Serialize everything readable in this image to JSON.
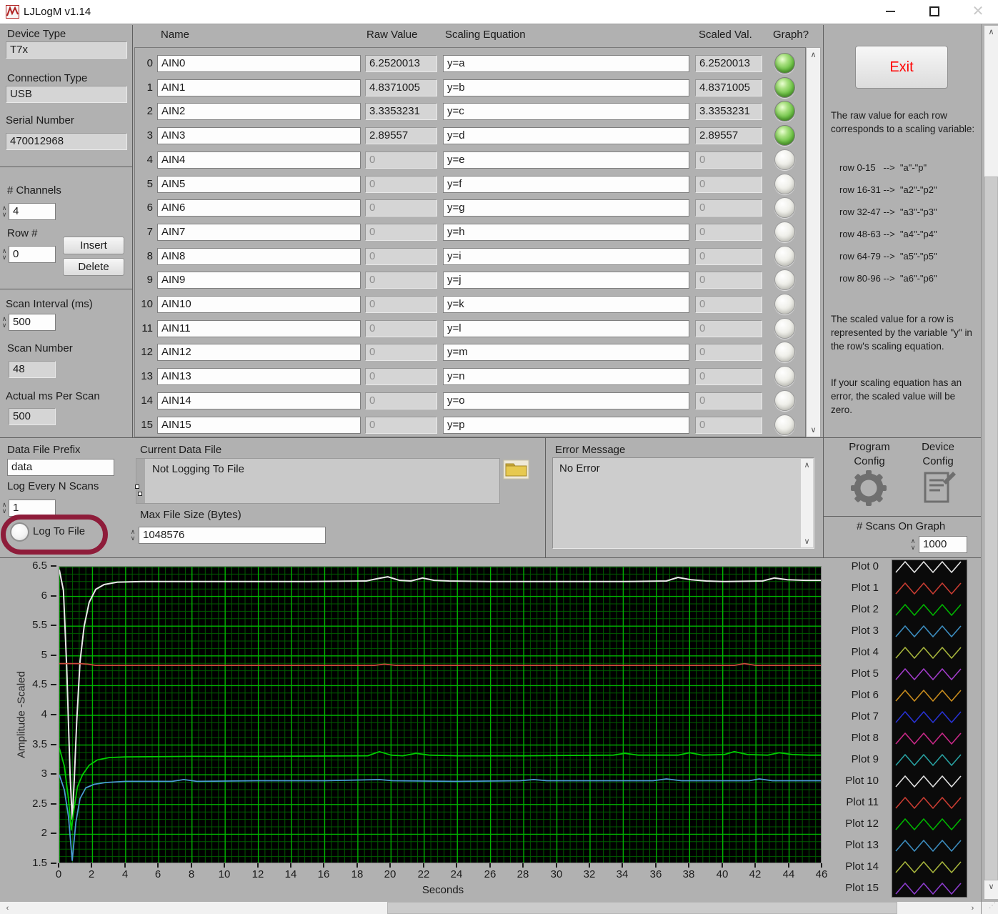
{
  "window": {
    "title": "LJLogM v1.14"
  },
  "left_panel": {
    "device_type_label": "Device Type",
    "device_type": "T7x",
    "connection_type_label": "Connection Type",
    "connection_type": "USB",
    "serial_number_label": "Serial Number",
    "serial_number": "470012968",
    "num_channels_label": "# Channels",
    "num_channels": "4",
    "row_label": "Row #",
    "row_value": "0",
    "insert_label": "Insert",
    "delete_label": "Delete",
    "scan_interval_label": "Scan Interval (ms)",
    "scan_interval": "500",
    "scan_number_label": "Scan Number",
    "scan_number": "48",
    "actual_ms_label": "Actual ms Per Scan",
    "actual_ms": "500"
  },
  "table": {
    "headers": {
      "name": "Name",
      "raw": "Raw Value",
      "equation": "Scaling Equation",
      "scaled": "Scaled Val.",
      "graph": "Graph?"
    },
    "rows": [
      {
        "idx": "0",
        "name": "AIN0",
        "raw": "6.2520013",
        "eq": "y=a",
        "scaled": "6.2520013",
        "on": true
      },
      {
        "idx": "1",
        "name": "AIN1",
        "raw": "4.8371005",
        "eq": "y=b",
        "scaled": "4.8371005",
        "on": true
      },
      {
        "idx": "2",
        "name": "AIN2",
        "raw": "3.3353231",
        "eq": "y=c",
        "scaled": "3.3353231",
        "on": true
      },
      {
        "idx": "3",
        "name": "AIN3",
        "raw": "2.89557",
        "eq": "y=d",
        "scaled": "2.89557",
        "on": true
      },
      {
        "idx": "4",
        "name": "AIN4",
        "raw": "0",
        "eq": "y=e",
        "scaled": "0",
        "on": false
      },
      {
        "idx": "5",
        "name": "AIN5",
        "raw": "0",
        "eq": "y=f",
        "scaled": "0",
        "on": false
      },
      {
        "idx": "6",
        "name": "AIN6",
        "raw": "0",
        "eq": "y=g",
        "scaled": "0",
        "on": false
      },
      {
        "idx": "7",
        "name": "AIN7",
        "raw": "0",
        "eq": "y=h",
        "scaled": "0",
        "on": false
      },
      {
        "idx": "8",
        "name": "AIN8",
        "raw": "0",
        "eq": "y=i",
        "scaled": "0",
        "on": false
      },
      {
        "idx": "9",
        "name": "AIN9",
        "raw": "0",
        "eq": "y=j",
        "scaled": "0",
        "on": false
      },
      {
        "idx": "10",
        "name": "AIN10",
        "raw": "0",
        "eq": "y=k",
        "scaled": "0",
        "on": false
      },
      {
        "idx": "11",
        "name": "AIN11",
        "raw": "0",
        "eq": "y=l",
        "scaled": "0",
        "on": false
      },
      {
        "idx": "12",
        "name": "AIN12",
        "raw": "0",
        "eq": "y=m",
        "scaled": "0",
        "on": false
      },
      {
        "idx": "13",
        "name": "AIN13",
        "raw": "0",
        "eq": "y=n",
        "scaled": "0",
        "on": false
      },
      {
        "idx": "14",
        "name": "AIN14",
        "raw": "0",
        "eq": "y=o",
        "scaled": "0",
        "on": false
      },
      {
        "idx": "15",
        "name": "AIN15",
        "raw": "0",
        "eq": "y=p",
        "scaled": "0",
        "on": false
      }
    ]
  },
  "right_panel": {
    "exit_label": "Exit",
    "raw_note": "The raw value for each row corresponds to a scaling variable:",
    "row_map": [
      "row 0-15   -->  \"a\"-\"p\"",
      "row 16-31 -->  \"a2\"-\"p2\"",
      "row 32-47 -->  \"a3\"-\"p3\"",
      "row 48-63 -->  \"a4\"-\"p4\"",
      "row 64-79 -->  \"a5\"-\"p5\"",
      "row 80-96 -->  \"a6\"-\"p6\""
    ],
    "scaled_note": "The scaled value for a row is represented by the variable  \"y\" in the row's scaling equation.",
    "error_note": "If your scaling  equation has an error, the scaled value will be zero."
  },
  "logging": {
    "data_file_prefix_label": "Data File Prefix",
    "data_file_prefix": "data",
    "log_every_label": "Log Every N Scans",
    "log_every": "1",
    "log_to_file_label": "Log To File",
    "current_data_file_label": "Current Data File",
    "current_data_file": "Not Logging To File",
    "max_file_size_label": "Max File Size (Bytes)",
    "max_file_size": "1048576"
  },
  "error_panel": {
    "label": "Error Message",
    "message": "No Error"
  },
  "config": {
    "program_label": "Program\nConfig",
    "device_label": "Device\nConfig"
  },
  "graph": {
    "scans_label": "# Scans On Graph",
    "scans_value": "1000",
    "legend": [
      {
        "label": "Plot 0",
        "color": "#e4e4e4"
      },
      {
        "label": "Plot 1",
        "color": "#c83c32"
      },
      {
        "label": "Plot 2",
        "color": "#00b400"
      },
      {
        "label": "Plot 3",
        "color": "#3c8cbe"
      },
      {
        "label": "Plot 4",
        "color": "#a6b43c"
      },
      {
        "label": "Plot 5",
        "color": "#a03cc8"
      },
      {
        "label": "Plot 6",
        "color": "#c88c1e"
      },
      {
        "label": "Plot 7",
        "color": "#2832d2"
      },
      {
        "label": "Plot 8",
        "color": "#c82887"
      },
      {
        "label": "Plot 9",
        "color": "#28a0a0"
      },
      {
        "label": "Plot 10",
        "color": "#e0e0e0"
      },
      {
        "label": "Plot 11",
        "color": "#c83c32"
      },
      {
        "label": "Plot 12",
        "color": "#00b400"
      },
      {
        "label": "Plot 13",
        "color": "#3c8cbe"
      },
      {
        "label": "Plot 14",
        "color": "#a6b43c"
      },
      {
        "label": "Plot 15",
        "color": "#8c3ccd"
      }
    ]
  },
  "colors": {
    "background": "#b1b1b1",
    "led_on": "#6cc244",
    "exit_text": "#ff0000",
    "annotation_ring": "#8e1c3a",
    "graph_bg": "#000000",
    "grid_major": "#00b400",
    "grid_minor": "#005c00"
  },
  "chart_data": {
    "type": "line",
    "xlabel": "Seconds",
    "ylabel": "Amplitude -Scaled",
    "xlim": [
      0,
      46
    ],
    "ylim": [
      1.5,
      6.5
    ],
    "x_ticks": [
      0,
      2,
      4,
      6,
      8,
      10,
      12,
      14,
      16,
      18,
      20,
      22,
      24,
      26,
      28,
      30,
      32,
      34,
      36,
      38,
      40,
      42,
      44,
      46
    ],
    "y_ticks": [
      6.5,
      6,
      5.5,
      5,
      4.5,
      4,
      3.5,
      3,
      2.5,
      2,
      1.5
    ],
    "grid": {
      "x_major": 2,
      "x_minor": 0.4,
      "y_major": 0.5,
      "y_minor": 0.125,
      "major_color": "#00b400",
      "minor_color": "#005c00"
    },
    "legend_position": "right",
    "series": [
      {
        "name": "AIN0",
        "color": "#e9e9e9",
        "points": [
          [
            0,
            6.45
          ],
          [
            0.25,
            6.1
          ],
          [
            0.45,
            4.8
          ],
          [
            0.65,
            3.0
          ],
          [
            0.78,
            2.25
          ],
          [
            0.9,
            2.9
          ],
          [
            1.05,
            3.9
          ],
          [
            1.25,
            4.9
          ],
          [
            1.5,
            5.5
          ],
          [
            1.8,
            5.9
          ],
          [
            2.2,
            6.12
          ],
          [
            2.7,
            6.2
          ],
          [
            3.5,
            6.24
          ],
          [
            5,
            6.25
          ],
          [
            10,
            6.25
          ],
          [
            15,
            6.25
          ],
          [
            18.5,
            6.26
          ],
          [
            19.2,
            6.3
          ],
          [
            19.8,
            6.33
          ],
          [
            20.5,
            6.27
          ],
          [
            21.2,
            6.26
          ],
          [
            21.9,
            6.31
          ],
          [
            22.6,
            6.27
          ],
          [
            23.5,
            6.26
          ],
          [
            26,
            6.25
          ],
          [
            30,
            6.25
          ],
          [
            34,
            6.25
          ],
          [
            36.6,
            6.26
          ],
          [
            37.3,
            6.32
          ],
          [
            38.1,
            6.28
          ],
          [
            39,
            6.26
          ],
          [
            40,
            6.25
          ],
          [
            42.4,
            6.26
          ],
          [
            43.1,
            6.31
          ],
          [
            43.9,
            6.28
          ],
          [
            45,
            6.27
          ],
          [
            46,
            6.27
          ]
        ]
      },
      {
        "name": "AIN1",
        "color": "#cd4a3c",
        "points": [
          [
            0,
            4.87
          ],
          [
            0.5,
            4.87
          ],
          [
            1.2,
            4.87
          ],
          [
            1.7,
            4.86
          ],
          [
            2.2,
            4.84
          ],
          [
            4,
            4.84
          ],
          [
            10,
            4.84
          ],
          [
            19,
            4.84
          ],
          [
            19.6,
            4.86
          ],
          [
            20.3,
            4.84
          ],
          [
            30,
            4.84
          ],
          [
            40.7,
            4.84
          ],
          [
            41.3,
            4.87
          ],
          [
            42,
            4.84
          ],
          [
            46,
            4.84
          ]
        ]
      },
      {
        "name": "AIN2",
        "color": "#00cd00",
        "points": [
          [
            0,
            3.45
          ],
          [
            0.3,
            3.15
          ],
          [
            0.55,
            2.6
          ],
          [
            0.72,
            2.07
          ],
          [
            0.9,
            2.45
          ],
          [
            1.1,
            2.8
          ],
          [
            1.4,
            3.0
          ],
          [
            1.8,
            3.16
          ],
          [
            2.3,
            3.25
          ],
          [
            3,
            3.29
          ],
          [
            4,
            3.3
          ],
          [
            8,
            3.31
          ],
          [
            12,
            3.31
          ],
          [
            18.6,
            3.32
          ],
          [
            19.3,
            3.39
          ],
          [
            20,
            3.33
          ],
          [
            20.7,
            3.32
          ],
          [
            21.5,
            3.36
          ],
          [
            22.3,
            3.33
          ],
          [
            24,
            3.32
          ],
          [
            28,
            3.32
          ],
          [
            33.4,
            3.33
          ],
          [
            34.1,
            3.36
          ],
          [
            34.9,
            3.33
          ],
          [
            37.3,
            3.33
          ],
          [
            38,
            3.37
          ],
          [
            38.8,
            3.33
          ],
          [
            40.1,
            3.34
          ],
          [
            40.7,
            3.39
          ],
          [
            41.5,
            3.34
          ],
          [
            42.7,
            3.33
          ],
          [
            43.4,
            3.37
          ],
          [
            44.2,
            3.34
          ],
          [
            45.2,
            3.33
          ],
          [
            46,
            3.33
          ]
        ]
      },
      {
        "name": "AIN3",
        "color": "#4a9ad2",
        "points": [
          [
            0,
            3.0
          ],
          [
            0.3,
            2.75
          ],
          [
            0.55,
            2.3
          ],
          [
            0.78,
            1.56
          ],
          [
            1.0,
            2.2
          ],
          [
            1.25,
            2.6
          ],
          [
            1.6,
            2.78
          ],
          [
            2.1,
            2.84
          ],
          [
            2.8,
            2.87
          ],
          [
            4,
            2.89
          ],
          [
            6.8,
            2.89
          ],
          [
            7.5,
            2.92
          ],
          [
            8.3,
            2.89
          ],
          [
            12,
            2.9
          ],
          [
            16,
            2.9
          ],
          [
            19.3,
            2.92
          ],
          [
            20.1,
            2.9
          ],
          [
            24,
            2.89
          ],
          [
            27.8,
            2.9
          ],
          [
            28.6,
            2.92
          ],
          [
            29.4,
            2.9
          ],
          [
            34,
            2.9
          ],
          [
            35.8,
            2.9
          ],
          [
            36.6,
            2.93
          ],
          [
            37.5,
            2.9
          ],
          [
            41.6,
            2.9
          ],
          [
            42.2,
            2.93
          ],
          [
            43,
            2.9
          ],
          [
            46,
            2.9
          ]
        ]
      }
    ]
  }
}
